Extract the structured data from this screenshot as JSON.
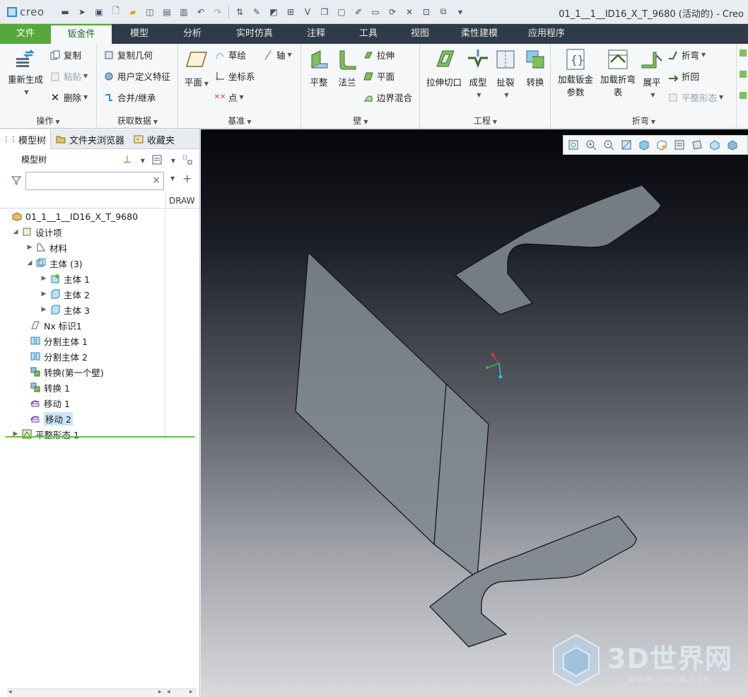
{
  "app": {
    "logo": "creo",
    "window_title": "01_1__1__ID16_X_T_9680 (活动的) - Creo"
  },
  "ribbon_tabs": [
    "文件",
    "钣金件",
    "模型",
    "分析",
    "实时仿真",
    "注释",
    "工具",
    "视图",
    "柔性建模",
    "应用程序"
  ],
  "ribbon": {
    "operations": {
      "regenerate": "重新生成",
      "copy": "复制",
      "paste": "粘贴",
      "delete": "删除",
      "label": "操作"
    },
    "get_data": {
      "copy_geometry": "复制几何",
      "udf": "用户定义特征",
      "merge": "合并/继承",
      "label": "获取数据"
    },
    "datum": {
      "plane": "平面",
      "sketch": "草绘",
      "axis": "轴",
      "csys": "坐标系",
      "point": "点",
      "label": "基准"
    },
    "wall": {
      "flat": "平整",
      "flange": "法兰",
      "extrude": "拉伸",
      "planar": "平面",
      "boundary_blend": "边界混合",
      "label": "壁"
    },
    "engineering": {
      "extrude_cut": "拉伸切口",
      "form": "成型",
      "rip": "扯裂",
      "convert": "转换",
      "label": "工程"
    },
    "bends": {
      "load_params_1": "加载钣金",
      "load_params_2": "参数",
      "load_bend_1": "加载折弯",
      "load_bend_2": "表",
      "unbend": "展平",
      "bend": "折弯",
      "bend_back": "折回",
      "flat_state": "平整形态",
      "label": "折弯"
    }
  },
  "left_pane": {
    "tabs": [
      "模型树",
      "文件夹浏览器",
      "收藏夹"
    ],
    "tree_title": "模型树",
    "filter_placeholder": "",
    "column_header": "DRAW",
    "tree": [
      {
        "label": "01_1__1__ID16_X_T_9680",
        "icon": "part-icon"
      },
      {
        "label": "设计项",
        "icon": "design-items-icon"
      },
      {
        "label": "材料",
        "icon": "material-icon"
      },
      {
        "label": "主体 (3)",
        "icon": "bodies-icon"
      },
      {
        "label": "主体 1",
        "icon": "body-default-icon"
      },
      {
        "label": "主体 2",
        "icon": "body-icon"
      },
      {
        "label": "主体 3",
        "icon": "body-icon"
      },
      {
        "label": "Nx 标识1",
        "icon": "nx-id-icon"
      },
      {
        "label": "分割主体 1",
        "icon": "split-body-icon"
      },
      {
        "label": "分割主体 2",
        "icon": "split-body-icon"
      },
      {
        "label": "转换(第一个壁)",
        "icon": "convert-first-wall-icon"
      },
      {
        "label": "转换 1",
        "icon": "convert-icon"
      },
      {
        "label": "移动 1",
        "icon": "move-icon"
      },
      {
        "label": "移动 2",
        "icon": "move-icon",
        "selected": true
      },
      {
        "label": "平整形态 1",
        "icon": "flat-state-icon"
      }
    ]
  },
  "viewport": {
    "watermark_main": "3D世界网",
    "watermark_sub": "WWW.3DSJW.COM"
  }
}
